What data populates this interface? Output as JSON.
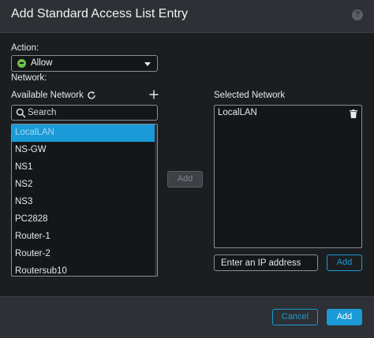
{
  "dialog": {
    "title": "Add Standard Access List Entry",
    "help_icon": "question-circle-icon",
    "help_glyph": "?"
  },
  "action": {
    "label": "Action:",
    "selected": "Allow",
    "icon": "allow-status-icon",
    "icon_color": "#6fbf4a"
  },
  "network": {
    "label": "Network:"
  },
  "available": {
    "label": "Available Network",
    "refresh_icon": "refresh-icon",
    "add_icon": "plus-icon",
    "search_placeholder": "Search",
    "items": [
      "LocalLAN",
      "NS-GW",
      "NS1",
      "NS2",
      "NS3",
      "PC2828",
      "Router-1",
      "Router-2",
      "Routersub10"
    ],
    "selected_item": "LocalLAN"
  },
  "middle": {
    "add_label": "Add"
  },
  "selected": {
    "label": "Selected Network",
    "items": [
      "LocalLAN"
    ],
    "delete_icon": "trash-icon"
  },
  "ip_entry": {
    "placeholder": "Enter an IP address",
    "add_label": "Add"
  },
  "footer": {
    "cancel_label": "Cancel",
    "add_label": "Add"
  },
  "colors": {
    "accent": "#1a9ad6",
    "background": "#1b1e21",
    "header": "#2d3034"
  }
}
